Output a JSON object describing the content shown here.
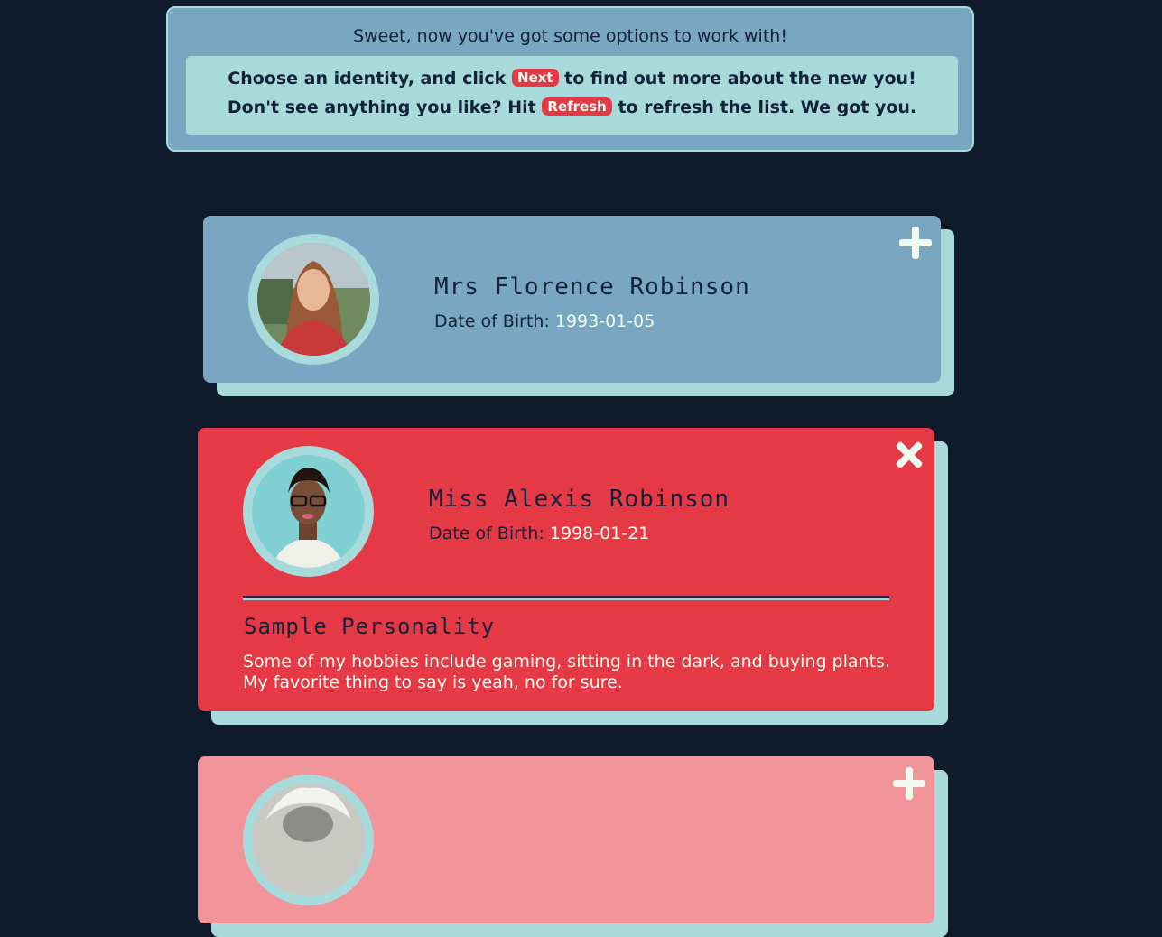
{
  "banner": {
    "title": "Sweet, now you've got some options to work with!",
    "line1_before": "Choose an identity, and click",
    "line1_pill": "Next",
    "line1_after": "to find out more about the new you!",
    "line2_before": "Don't see anything you like? Hit",
    "line2_pill": "Refresh",
    "line2_after": "to refresh the list. We got you."
  },
  "cards": [
    {
      "name": "Mrs Florence Robinson",
      "dob_label": "Date of Birth:",
      "dob": "1993-01-05",
      "action_icon": "plus-icon",
      "expanded": false,
      "color": "#79a6c0"
    },
    {
      "name": "Miss Alexis Robinson",
      "dob_label": "Date of Birth:",
      "dob": "1998-01-21",
      "action_icon": "close-icon",
      "expanded": true,
      "color": "#e63946",
      "sample_title": "Sample Personality",
      "sample_line1": "Some of my hobbies include gaming, sitting in the dark, and buying plants.",
      "sample_line2": "My favorite thing to say is yeah, no for sure."
    },
    {
      "name": "",
      "action_icon": "plus-icon",
      "expanded": false,
      "color": "#f1959b"
    }
  ],
  "colors": {
    "background": "#0f1b2d",
    "accent": "#e63946",
    "light": "#a8dadc",
    "steel": "#79a6c0",
    "pink": "#f1959b",
    "text_dark": "#13213a"
  }
}
